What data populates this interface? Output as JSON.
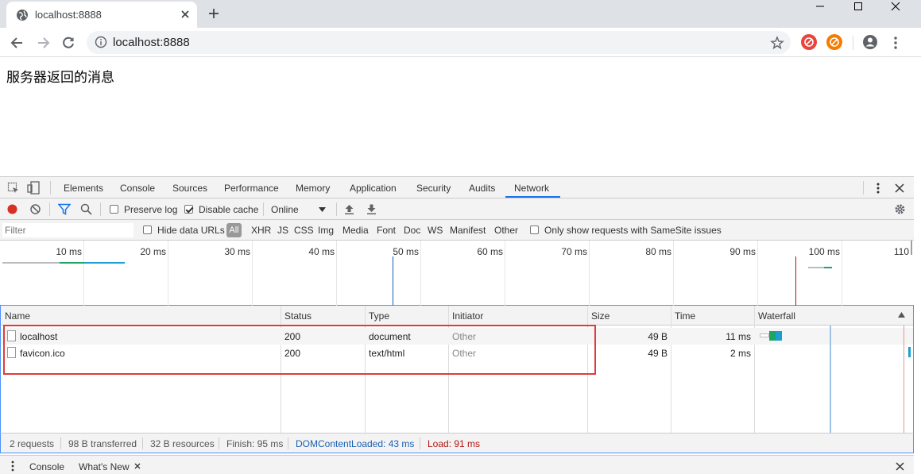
{
  "browser": {
    "tab_title": "localhost:8888",
    "url": "localhost:8888",
    "icons": [
      "globe-icon",
      "close-icon",
      "plus-icon",
      "minimize-icon",
      "maximize-icon",
      "back-icon",
      "forward-icon",
      "reload-icon",
      "info-icon",
      "star-icon",
      "extension-icon",
      "profile-icon",
      "menu-icon"
    ],
    "colors": {
      "ext1": "#e8453c",
      "ext2": "#f57c00"
    }
  },
  "page": {
    "message": "服务器返回的消息"
  },
  "devtools": {
    "tabs": [
      "Elements",
      "Console",
      "Sources",
      "Performance",
      "Memory",
      "Application",
      "Security",
      "Audits",
      "Network"
    ],
    "active_tab": "Network",
    "toolbar": {
      "preserve_log": "Preserve log",
      "disable_cache": "Disable cache",
      "throttle": "Online"
    },
    "filter": {
      "placeholder": "Filter",
      "hide_data_urls": "Hide data URLs",
      "types": [
        "All",
        "XHR",
        "JS",
        "CSS",
        "Img",
        "Media",
        "Font",
        "Doc",
        "WS",
        "Manifest",
        "Other"
      ],
      "samesite": "Only show requests with SameSite issues"
    },
    "overview_ticks": [
      "10 ms",
      "20 ms",
      "30 ms",
      "40 ms",
      "50 ms",
      "60 ms",
      "70 ms",
      "80 ms",
      "90 ms",
      "100 ms",
      "110"
    ],
    "columns": [
      "Name",
      "Status",
      "Type",
      "Initiator",
      "Size",
      "Time",
      "Waterfall"
    ],
    "rows": [
      {
        "name": "localhost",
        "status": "200",
        "type": "document",
        "initiator": "Other",
        "size": "49 B",
        "time": "11 ms"
      },
      {
        "name": "favicon.ico",
        "status": "200",
        "type": "text/html",
        "initiator": "Other",
        "size": "49 B",
        "time": "2 ms"
      }
    ],
    "summary": {
      "requests": "2 requests",
      "transferred": "98 B transferred",
      "resources": "32 B resources",
      "finish": "Finish: 95 ms",
      "dcl": "DOMContentLoaded: 43 ms",
      "load": "Load: 91 ms"
    },
    "drawer_tabs": [
      "Console",
      "What's New"
    ],
    "colors": {
      "dcl": "#1a5fb4",
      "load": "#b31412",
      "active_underline": "#1a73e8",
      "highlight": "#e03c3c"
    }
  }
}
